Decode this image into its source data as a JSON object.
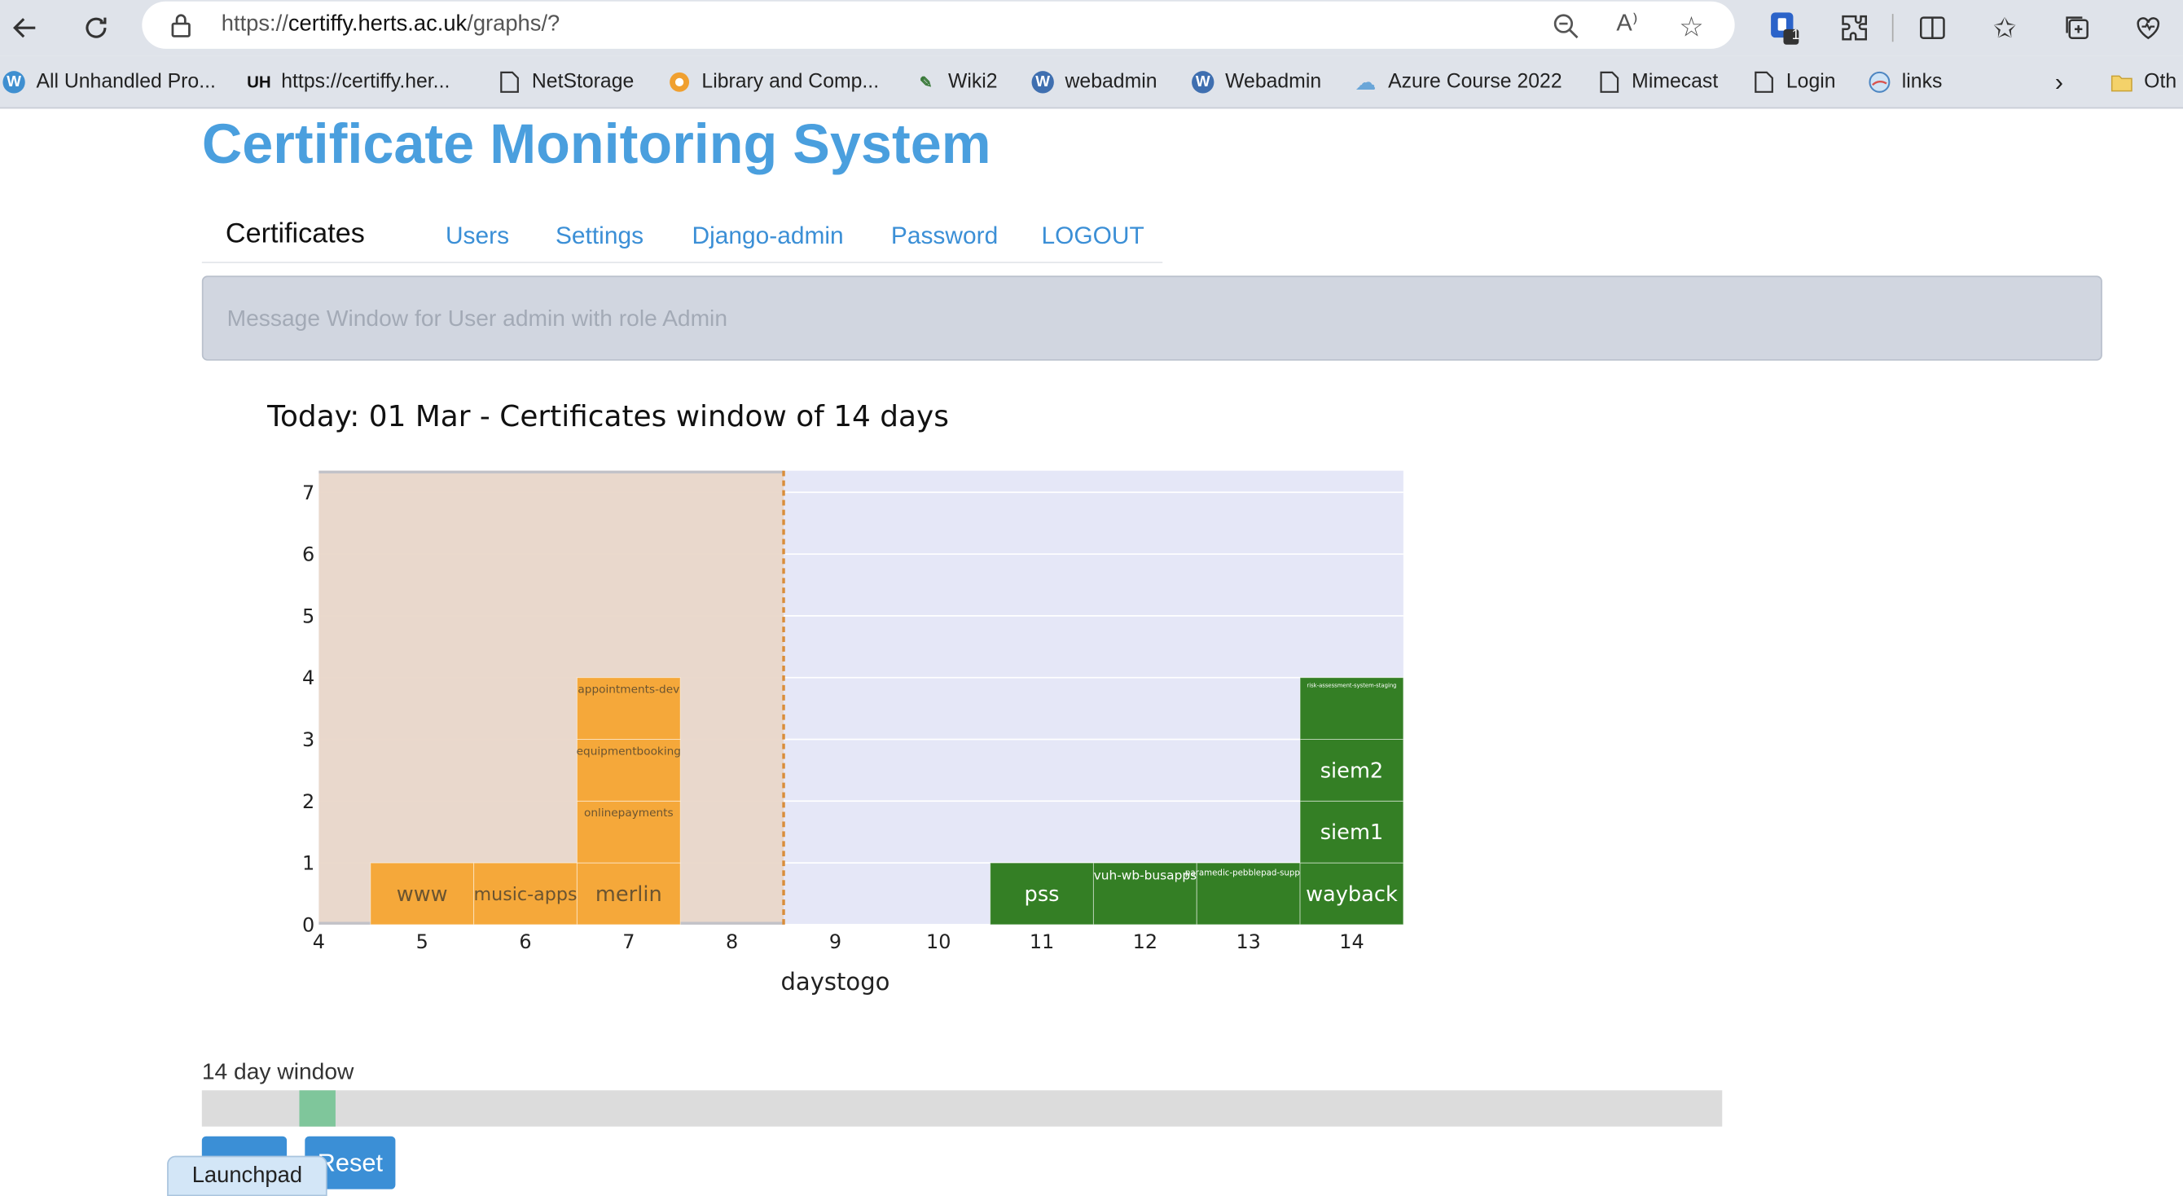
{
  "browser": {
    "url_scheme": "https://",
    "url_host": "certiffy.herts.ac.uk",
    "url_path": "/graphs/?",
    "extension_badge": "1",
    "bookmarks": [
      {
        "label": "All Unhandled Pro...",
        "icon": "wordpress-icon"
      },
      {
        "label": "https://certiffy.her...",
        "icon": "uh-logo-icon"
      },
      {
        "label": "NetStorage",
        "icon": "page-icon"
      },
      {
        "label": "Library and Comp...",
        "icon": "lifebuoy-icon"
      },
      {
        "label": "Wiki2",
        "icon": "wiki-icon"
      },
      {
        "label": "webadmin",
        "icon": "wordpress-icon"
      },
      {
        "label": "Webadmin",
        "icon": "wordpress-icon"
      },
      {
        "label": "Azure Course 2022",
        "icon": "cloud-icon"
      },
      {
        "label": "Mimecast",
        "icon": "page-icon"
      },
      {
        "label": "Login",
        "icon": "page-icon"
      },
      {
        "label": "links",
        "icon": "globe-icon"
      }
    ],
    "other_bookmarks": "Oth"
  },
  "page": {
    "title": "Certificate Monitoring System",
    "nav": [
      {
        "label": "Certificates",
        "active": true
      },
      {
        "label": "Users",
        "active": false
      },
      {
        "label": "Settings",
        "active": false
      },
      {
        "label": "Django-admin",
        "active": false
      },
      {
        "label": "Password",
        "active": false
      },
      {
        "label": "LOGOUT",
        "active": false
      }
    ],
    "message": "Message Window for User admin with role Admin"
  },
  "chart_data": {
    "type": "bar",
    "title": "Today: 01 Mar - Certificates window of 14 days",
    "xlabel": "daystogo",
    "ylabel": "",
    "xlim": [
      4,
      14.5
    ],
    "ylim": [
      0,
      7.35
    ],
    "x_ticks": [
      4,
      5,
      6,
      7,
      8,
      9,
      10,
      11,
      12,
      13,
      14
    ],
    "y_ticks": [
      0,
      1,
      2,
      3,
      4,
      5,
      6,
      7
    ],
    "shaded_region": {
      "from": 4,
      "to": 8.5,
      "color": "#e9d7c9"
    },
    "plot_background": "#e5e7f7",
    "colors": {
      "warning": "#f5a83a",
      "ok": "#347f25"
    },
    "bars": [
      {
        "x": 5,
        "stack": 0,
        "label": "www",
        "status": "warning"
      },
      {
        "x": 6,
        "stack": 0,
        "label": "music-apps",
        "status": "warning"
      },
      {
        "x": 7,
        "stack": 0,
        "label": "merlin",
        "status": "warning"
      },
      {
        "x": 7,
        "stack": 1,
        "label": "onlinepayments",
        "status": "warning"
      },
      {
        "x": 7,
        "stack": 2,
        "label": "equipmentbooking",
        "status": "warning"
      },
      {
        "x": 7,
        "stack": 3,
        "label": "appointments-dev",
        "status": "warning"
      },
      {
        "x": 11,
        "stack": 0,
        "label": "pss",
        "status": "ok"
      },
      {
        "x": 12,
        "stack": 0,
        "label": "vuh-wb-busapps",
        "status": "ok"
      },
      {
        "x": 13,
        "stack": 0,
        "label": "paramedic-pebblepad-support",
        "status": "ok"
      },
      {
        "x": 14,
        "stack": 0,
        "label": "wayback",
        "status": "ok"
      },
      {
        "x": 14,
        "stack": 1,
        "label": "siem1",
        "status": "ok"
      },
      {
        "x": 14,
        "stack": 2,
        "label": "siem2",
        "status": "ok"
      },
      {
        "x": 14,
        "stack": 3,
        "label": "risk-assessment-system-staging",
        "status": "ok"
      }
    ]
  },
  "slider": {
    "label": "14 day window",
    "position": 0.064
  },
  "buttons": {
    "play": "",
    "reset": "Reset"
  },
  "launchpad": "Launchpad"
}
